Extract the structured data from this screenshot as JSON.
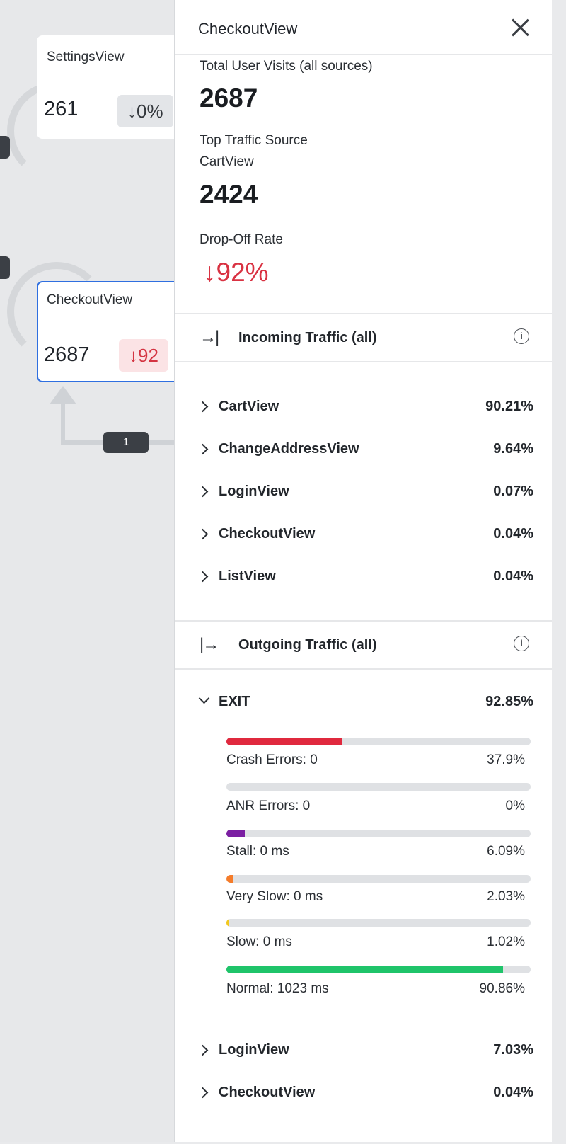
{
  "canvas": {
    "settings_node": {
      "title": "SettingsView",
      "count": "261",
      "badge": "↓0%"
    },
    "checkout_node": {
      "title": "CheckoutView",
      "count": "2687",
      "badge": "↓92"
    },
    "edge_count": "1"
  },
  "panel": {
    "title": "CheckoutView",
    "stats": {
      "total_label": "Total User Visits (all sources)",
      "total_value": "2687",
      "top_source_label": "Top Traffic Source",
      "top_source_name": "CartView",
      "top_source_value": "2424",
      "dropoff_label": "Drop-Off Rate",
      "dropoff_value": "↓92%"
    },
    "incoming": {
      "title": "Incoming Traffic (all)",
      "icon": "→|",
      "items": [
        {
          "label": "CartView",
          "pct": "90.21%"
        },
        {
          "label": "ChangeAddressView",
          "pct": "9.64%"
        },
        {
          "label": "LoginView",
          "pct": "0.07%"
        },
        {
          "label": "CheckoutView",
          "pct": "0.04%"
        },
        {
          "label": "ListView",
          "pct": "0.04%"
        }
      ]
    },
    "outgoing": {
      "title": "Outgoing Traffic (all)",
      "icon": "|→",
      "exit": {
        "label": "EXIT",
        "pct": "92.85%",
        "breakdown": [
          {
            "label": "Crash Errors: 0",
            "pct": "37.9%",
            "fill": 0.379,
            "color": "#e0293e"
          },
          {
            "label": "ANR Errors: 0",
            "pct": "0%",
            "fill": 0.0,
            "color": "#9b9ea3"
          },
          {
            "label": "Stall: 0 ms",
            "pct": "6.09%",
            "fill": 0.0609,
            "color": "#7b1fa2"
          },
          {
            "label": "Very Slow: 0 ms",
            "pct": "2.03%",
            "fill": 0.0203,
            "color": "#f57c2a"
          },
          {
            "label": "Slow: 0 ms",
            "pct": "1.02%",
            "fill": 0.0102,
            "color": "#f2c81d"
          },
          {
            "label": "Normal: 1023 ms",
            "pct": "90.86%",
            "fill": 0.9086,
            "color": "#1fc46a"
          }
        ]
      },
      "items": [
        {
          "label": "LoginView",
          "pct": "7.03%"
        },
        {
          "label": "CheckoutView",
          "pct": "0.04%"
        }
      ]
    }
  }
}
